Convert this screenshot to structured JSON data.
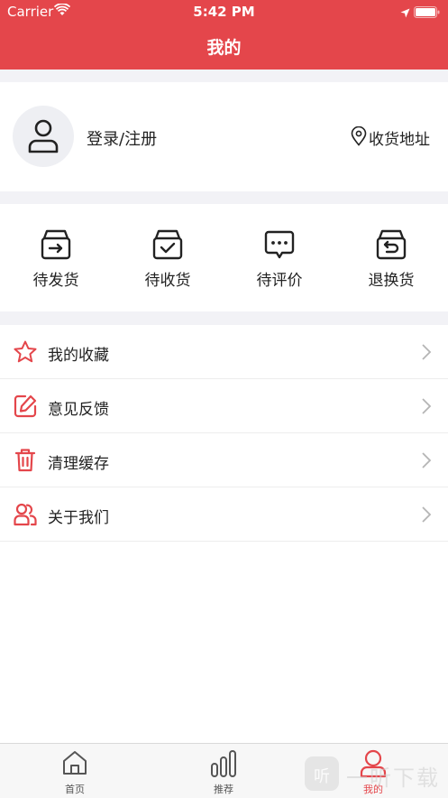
{
  "status_bar": {
    "carrier": "Carrier",
    "time": "5:42 PM"
  },
  "header": {
    "title": "我的"
  },
  "profile": {
    "login_label": "登录/注册",
    "address_label": "收货地址"
  },
  "orders": [
    {
      "label": "待发货",
      "icon": "ship-box-icon"
    },
    {
      "label": "待收货",
      "icon": "receive-box-icon"
    },
    {
      "label": "待评价",
      "icon": "comment-icon"
    },
    {
      "label": "退换货",
      "icon": "return-box-icon"
    }
  ],
  "menu": [
    {
      "label": "我的收藏",
      "icon": "star-icon"
    },
    {
      "label": "意见反馈",
      "icon": "edit-icon"
    },
    {
      "label": "清理缓存",
      "icon": "trash-icon"
    },
    {
      "label": "关于我们",
      "icon": "users-icon"
    }
  ],
  "tabs": [
    {
      "label": "首页",
      "icon": "home-icon",
      "active": false
    },
    {
      "label": "推荐",
      "icon": "bars-icon",
      "active": false
    },
    {
      "label": "我的",
      "icon": "user-icon",
      "active": true
    }
  ],
  "watermark": {
    "badge": "听",
    "text": "一听下载"
  },
  "colors": {
    "accent": "#e4464b",
    "background_gap": "#f2f2f6",
    "text": "#222222"
  }
}
